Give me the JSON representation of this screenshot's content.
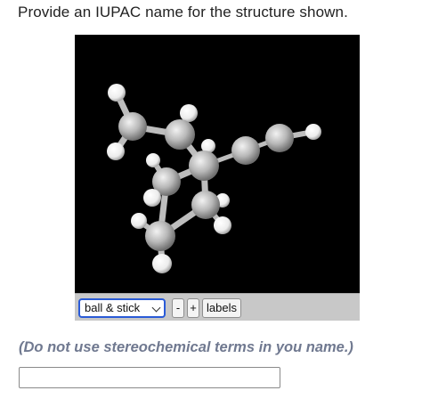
{
  "question": {
    "text": "Provide an IUPAC name for the structure shown."
  },
  "viewer": {
    "style_select_value": "ball & stick",
    "zoom_out_label": "-",
    "zoom_in_label": "+",
    "labels_button": "labels",
    "colors": {
      "background": "#000000",
      "carbon": "#c0c0c0",
      "hydrogen": "#ffffff",
      "toolbar": "#c8c8c8",
      "select_border": "#2a5bd7"
    }
  },
  "instructions": {
    "note": "(Do not use stereochemical terms in you name.)"
  },
  "answer_field": {
    "value": "",
    "placeholder": ""
  }
}
